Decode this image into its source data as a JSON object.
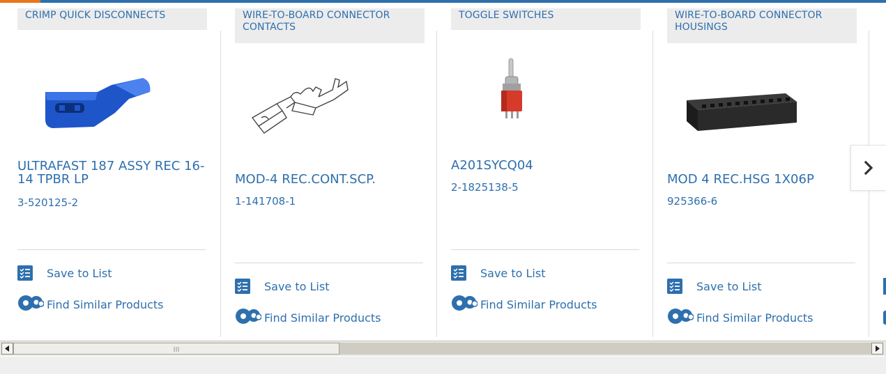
{
  "products": [
    {
      "category": "CRIMP QUICK DISCONNECTS",
      "name": "ULTRAFAST 187 ASSY REC 16-14 TPBR LP",
      "part_number": "3-520125-2",
      "save_label": "Save to List",
      "find_label": "Find Similar Products"
    },
    {
      "category": "WIRE-TO-BOARD CONNECTOR CONTACTS",
      "name": "MOD-4 REC.CONT.SCP.",
      "part_number": "1-141708-1",
      "save_label": "Save to List",
      "find_label": "Find Similar Products"
    },
    {
      "category": "TOGGLE SWITCHES",
      "name": "A201SYCQ04",
      "part_number": "2-1825138-5",
      "save_label": "Save to List",
      "find_label": "Find Similar Products"
    },
    {
      "category": "WIRE-TO-BOARD CONNECTOR HOUSINGS",
      "name": "MOD 4 REC.HSG 1X06P",
      "part_number": "925366-6",
      "save_label": "Save to List",
      "find_label": "Find Similar Products"
    }
  ],
  "colors": {
    "brand_blue": "#2e6fad",
    "accent_orange": "#e8751a",
    "category_bg": "#ececec"
  },
  "icons": {
    "save": "checklist-icon",
    "find": "gears-icon",
    "next": "chevron-right-icon"
  },
  "scrollbar": {
    "thumb_position": 0.0,
    "visible_fraction": 0.37
  }
}
